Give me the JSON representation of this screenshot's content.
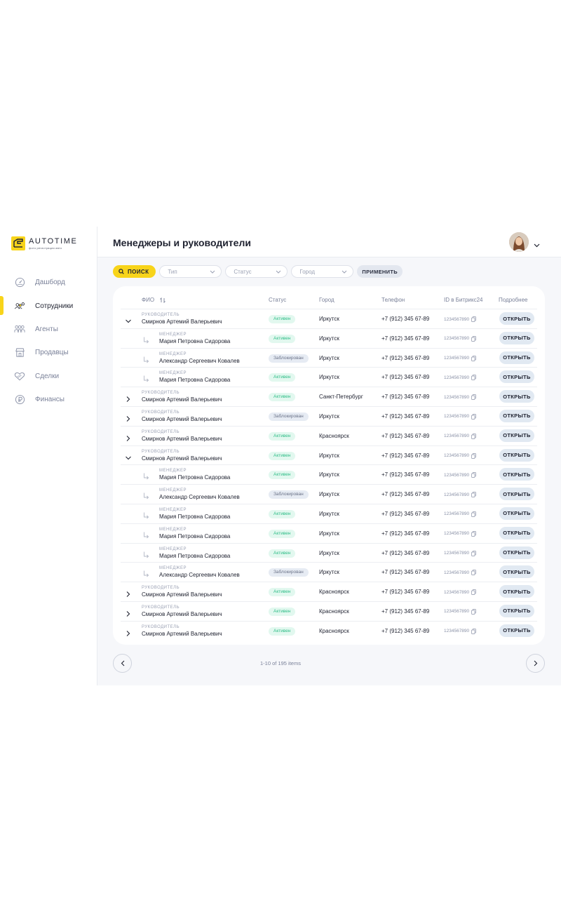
{
  "brand": {
    "name": "AUTOTIME",
    "tagline": "фото регистрация авто"
  },
  "nav": [
    {
      "label": "Дашборд",
      "icon": "dashboard-icon",
      "active": false
    },
    {
      "label": "Сотрудники",
      "icon": "employees-icon",
      "active": true
    },
    {
      "label": "Агенты",
      "icon": "agents-icon",
      "active": false
    },
    {
      "label": "Продавцы",
      "icon": "store-icon",
      "active": false
    },
    {
      "label": "Сделки",
      "icon": "handshake-icon",
      "active": false
    },
    {
      "label": "Финансы",
      "icon": "ruble-icon",
      "active": false
    }
  ],
  "header": {
    "title": "Менеджеры и руководители"
  },
  "filters": {
    "search_label": "ПОИСК",
    "type_placeholder": "Тип",
    "status_placeholder": "Статус",
    "city_placeholder": "Город",
    "apply_label": "ПРИМЕНИТЬ"
  },
  "table": {
    "columns": {
      "name": "ФИО",
      "status": "Статус",
      "city": "Город",
      "phone": "Телефон",
      "bitrix_id": "ID в Битрикс24",
      "details": "Подробнее"
    },
    "open_label": "ОТКРЫТЬ",
    "rows": [
      {
        "level": "head",
        "expanded": true,
        "role": "РУКОВОДИТЕЛЬ",
        "name": "Смирнов Артемий Валерьевич",
        "status": "Активен",
        "status_type": "active",
        "city": "Иркутск",
        "phone": "+7 (912) 345 67-89",
        "bitrix_id": "1234567890"
      },
      {
        "level": "sub",
        "role": "МЕНЕДЖЕР",
        "name": "Мария Петровна Сидорова",
        "status": "Активен",
        "status_type": "active",
        "city": "Иркутск",
        "phone": "+7 (912) 345 67-89",
        "bitrix_id": "1234567890"
      },
      {
        "level": "sub",
        "role": "МЕНЕДЖЕР",
        "name": "Александр Сергеевич Ковалев",
        "status": "Заблокирован",
        "status_type": "blocked",
        "city": "Иркутск",
        "phone": "+7 (912) 345 67-89",
        "bitrix_id": "1234567890"
      },
      {
        "level": "sub",
        "role": "МЕНЕДЖЕР",
        "name": "Мария Петровна Сидорова",
        "status": "Активен",
        "status_type": "active",
        "city": "Иркутск",
        "phone": "+7 (912) 345 67-89",
        "bitrix_id": "1234567890"
      },
      {
        "level": "head",
        "expanded": false,
        "role": "РУКОВОДИТЕЛЬ",
        "name": "Смирнов Артемий Валерьевич",
        "status": "Активен",
        "status_type": "active",
        "city": "Санкт-Петербург",
        "phone": "+7 (912) 345 67-89",
        "bitrix_id": "1234567890"
      },
      {
        "level": "head",
        "expanded": false,
        "role": "РУКОВОДИТЕЛЬ",
        "name": "Смирнов Артемий Валерьевич",
        "status": "Заблокирован",
        "status_type": "blocked",
        "city": "Иркутск",
        "phone": "+7 (912) 345 67-89",
        "bitrix_id": "1234567890"
      },
      {
        "level": "head",
        "expanded": false,
        "role": "РУКОВОДИТЕЛЬ",
        "name": "Смирнов Артемий Валерьевич",
        "status": "Активен",
        "status_type": "active",
        "city": "Красноярск",
        "phone": "+7 (912) 345 67-89",
        "bitrix_id": "1234567890"
      },
      {
        "level": "head",
        "expanded": true,
        "role": "РУКОВОДИТЕЛЬ",
        "name": "Смирнов Артемий Валерьевич",
        "status": "Активен",
        "status_type": "active",
        "city": "Иркутск",
        "phone": "+7 (912) 345 67-89",
        "bitrix_id": "1234567890"
      },
      {
        "level": "sub",
        "role": "МЕНЕДЖЕР",
        "name": "Мария Петровна Сидорова",
        "status": "Активен",
        "status_type": "active",
        "city": "Иркутск",
        "phone": "+7 (912) 345 67-89",
        "bitrix_id": "1234567890"
      },
      {
        "level": "sub",
        "role": "МЕНЕДЖЕР",
        "name": "Александр Сергеевич Ковалев",
        "status": "Заблокирован",
        "status_type": "blocked",
        "city": "Иркутск",
        "phone": "+7 (912) 345 67-89",
        "bitrix_id": "1234567890"
      },
      {
        "level": "sub",
        "role": "МЕНЕДЖЕР",
        "name": "Мария Петровна Сидорова",
        "status": "Активен",
        "status_type": "active",
        "city": "Иркутск",
        "phone": "+7 (912) 345 67-89",
        "bitrix_id": "1234567890"
      },
      {
        "level": "sub",
        "role": "МЕНЕДЖЕР",
        "name": "Мария Петровна Сидорова",
        "status": "Активен",
        "status_type": "active",
        "city": "Иркутск",
        "phone": "+7 (912) 345 67-89",
        "bitrix_id": "1234567890"
      },
      {
        "level": "sub",
        "role": "МЕНЕДЖЕР",
        "name": "Мария Петровна Сидорова",
        "status": "Активен",
        "status_type": "active",
        "city": "Иркутск",
        "phone": "+7 (912) 345 67-89",
        "bitrix_id": "1234567890"
      },
      {
        "level": "sub",
        "role": "МЕНЕДЖЕР",
        "name": "Александр Сергеевич Ковалев",
        "status": "Заблокирован",
        "status_type": "blocked",
        "city": "Иркутск",
        "phone": "+7 (912) 345 67-89",
        "bitrix_id": "1234567890"
      },
      {
        "level": "head",
        "expanded": false,
        "role": "РУКОВОДИТЕЛЬ",
        "name": "Смирнов Артемий Валерьевич",
        "status": "Активен",
        "status_type": "active",
        "city": "Красноярск",
        "phone": "+7 (912) 345 67-89",
        "bitrix_id": "1234567890"
      },
      {
        "level": "head",
        "expanded": false,
        "role": "РУКОВОДИТЕЛЬ",
        "name": "Смирнов Артемий Валерьевич",
        "status": "Активен",
        "status_type": "active",
        "city": "Красноярск",
        "phone": "+7 (912) 345 67-89",
        "bitrix_id": "1234567890"
      },
      {
        "level": "head",
        "expanded": false,
        "role": "РУКОВОДИТЕЛЬ",
        "name": "Смирнов Артемий Валерьевич",
        "status": "Активен",
        "status_type": "active",
        "city": "Красноярск",
        "phone": "+7 (912) 345 67-89",
        "bitrix_id": "1234567890"
      }
    ]
  },
  "pagination": {
    "info": "1-10 of 195 items"
  },
  "colors": {
    "accent": "#f8d41a",
    "active": "#2fbd87",
    "blocked": "#6c7489"
  }
}
